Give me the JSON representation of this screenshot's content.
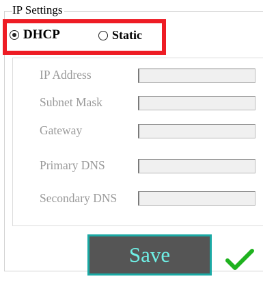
{
  "group": {
    "title": "IP Settings"
  },
  "mode": {
    "options": [
      {
        "label": "DHCP",
        "selected": true
      },
      {
        "label": "Static",
        "selected": false
      }
    ]
  },
  "fields": [
    {
      "label": "IP Address",
      "value": ""
    },
    {
      "label": "Subnet Mask",
      "value": ""
    },
    {
      "label": "Gateway",
      "value": ""
    },
    {
      "label": "Primary DNS",
      "value": ""
    },
    {
      "label": "Secondary DNS",
      "value": ""
    }
  ],
  "actions": {
    "save_label": "Save"
  },
  "status": {
    "icon": "checkmark-icon",
    "color": "#1fb21f"
  },
  "colors": {
    "highlight": "#ee1c24",
    "button_bg": "#555555",
    "button_border": "#1aa9a4",
    "button_text": "#6ff0e6",
    "disabled_label": "#9a9a9a"
  }
}
